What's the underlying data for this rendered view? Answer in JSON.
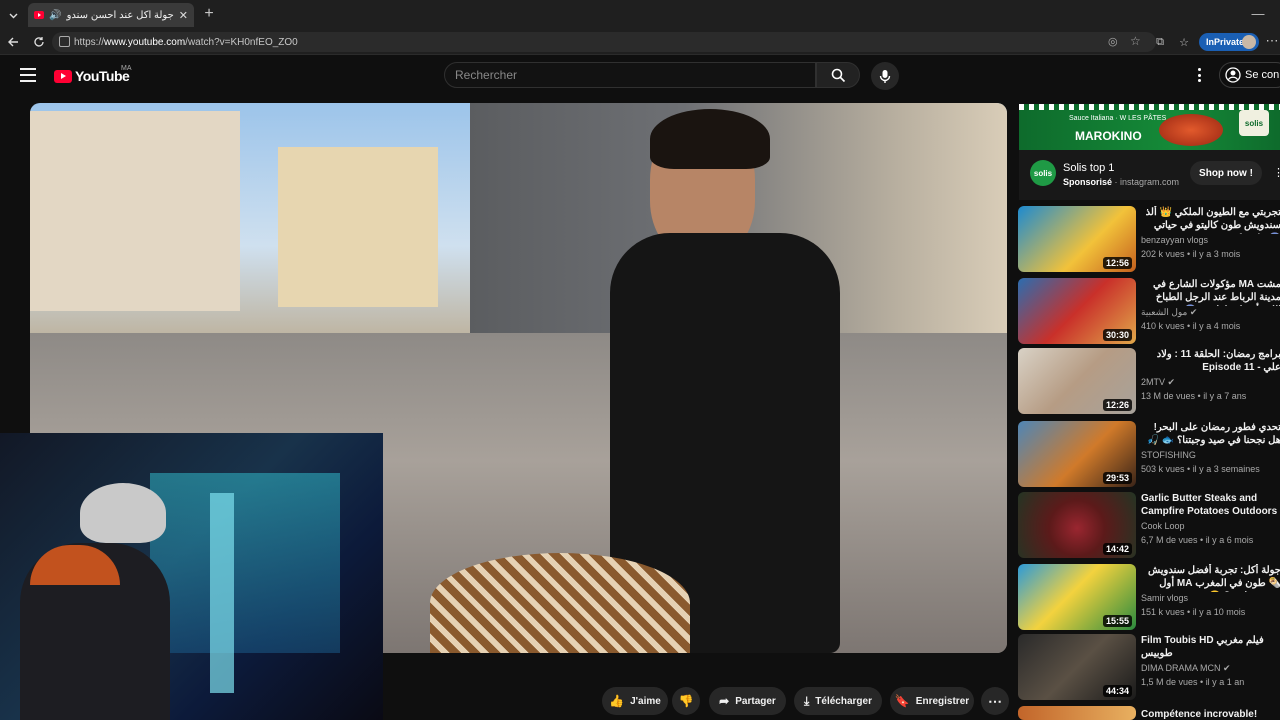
{
  "browser": {
    "tab_title": "جولة أكل عند احسن سندويتشات",
    "url_prefix": "https://",
    "url_host": "www.youtube.com",
    "url_path": "/watch?v=KH0nfEO_ZO0",
    "inprivate_label": "InPrivate"
  },
  "youtube": {
    "logo_text": "YouTube",
    "country_code": "MA",
    "search_placeholder": "Rechercher",
    "signin_label": "Se conn"
  },
  "actions": {
    "like": "J'aime",
    "share": "Partager",
    "download": "Télécharger",
    "save": "Enregistrer"
  },
  "ad": {
    "banner_text": "MAROKINO",
    "banner_sub": "Sauce Italiana · W LES PÂTES",
    "brand": "solis",
    "title": "Solis top 1",
    "sponsored": "Sponsorisé",
    "domain": "instagram.com",
    "cta": "Shop now !"
  },
  "recommendations": [
    {
      "title": "تجربتي مع الطيون الملكي 👑 ألذ سندويش طون كاليتو في حياتي 😱 #streetfood",
      "channel": "benzayyan vlogs",
      "views": "202 k vues",
      "age": "il y a 3 mois",
      "duration": "12:56",
      "verified": false
    },
    {
      "title": "مشت MA مؤكولات الشارع في مدينة الرباط عند الرجل الطباخ الله وأفضل طواجين 😱",
      "channel": "مول الشعبية",
      "views": "410 k vues",
      "age": "il y a 4 mois",
      "duration": "30:30",
      "verified": true
    },
    {
      "title": "برامج رمضان: الحلقة 11 : ولاد علي - Episode 11",
      "channel": "2MTV",
      "views": "13 M de vues",
      "age": "il y a 7 ans",
      "duration": "12:26",
      "verified": true
    },
    {
      "title": "تحدي فطور رمضان على البحر! هل نجحنا في صيد وجبتنا؟ 🐟 🎣",
      "channel": "STOFISHING",
      "views": "503 k vues",
      "age": "il y a 3 semaines",
      "duration": "29:53",
      "verified": false
    },
    {
      "title": "Garlic Butter Steaks and Campfire Potatoes Outdoors",
      "channel": "Cook Loop",
      "views": "6,7 M de vues",
      "age": "il y a 6 mois",
      "duration": "14:42",
      "verified": false
    },
    {
      "title": "جولة أكل: تجربة أفضل سندويش 🌯 طون في المغرب MA أول وحدين داروه؟ 😋",
      "channel": "Samir vlogs",
      "views": "151 k vues",
      "age": "il y a 10 mois",
      "duration": "15:55",
      "verified": false
    },
    {
      "title": "Film Toubis HD فيلم مغربي طوبيس",
      "channel": "DIMA DRAMA MCN",
      "views": "1,5 M de vues",
      "age": "il y a 1 an",
      "duration": "44:34",
      "verified": true
    },
    {
      "title": "Compétence incrovable!",
      "channel": "",
      "views": "",
      "age": "",
      "duration": "",
      "verified": false
    }
  ],
  "colors": {
    "background": "#0f0f0f",
    "brand_red": "#ff0033",
    "inprivate_blue": "#1a5fb4",
    "ad_green": "#158a38"
  }
}
